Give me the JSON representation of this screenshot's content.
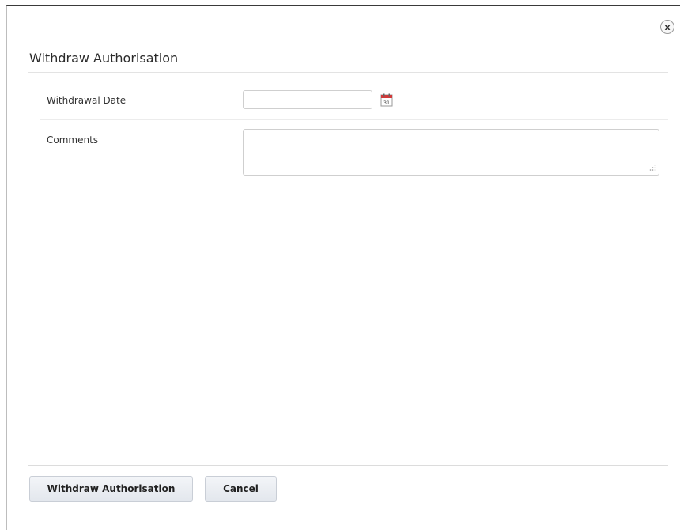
{
  "dialog": {
    "title": "Withdraw Authorisation",
    "close_glyph": "x"
  },
  "form": {
    "withdrawal_date": {
      "label": "Withdrawal Date",
      "value": "",
      "icon": "calendar-icon",
      "icon_day": "31"
    },
    "comments": {
      "label": "Comments",
      "value": ""
    }
  },
  "footer": {
    "primary_label": "Withdraw Authorisation",
    "cancel_label": "Cancel"
  },
  "colors": {
    "calendar_red": "#d23a3a",
    "button_border": "#c9ced6"
  }
}
